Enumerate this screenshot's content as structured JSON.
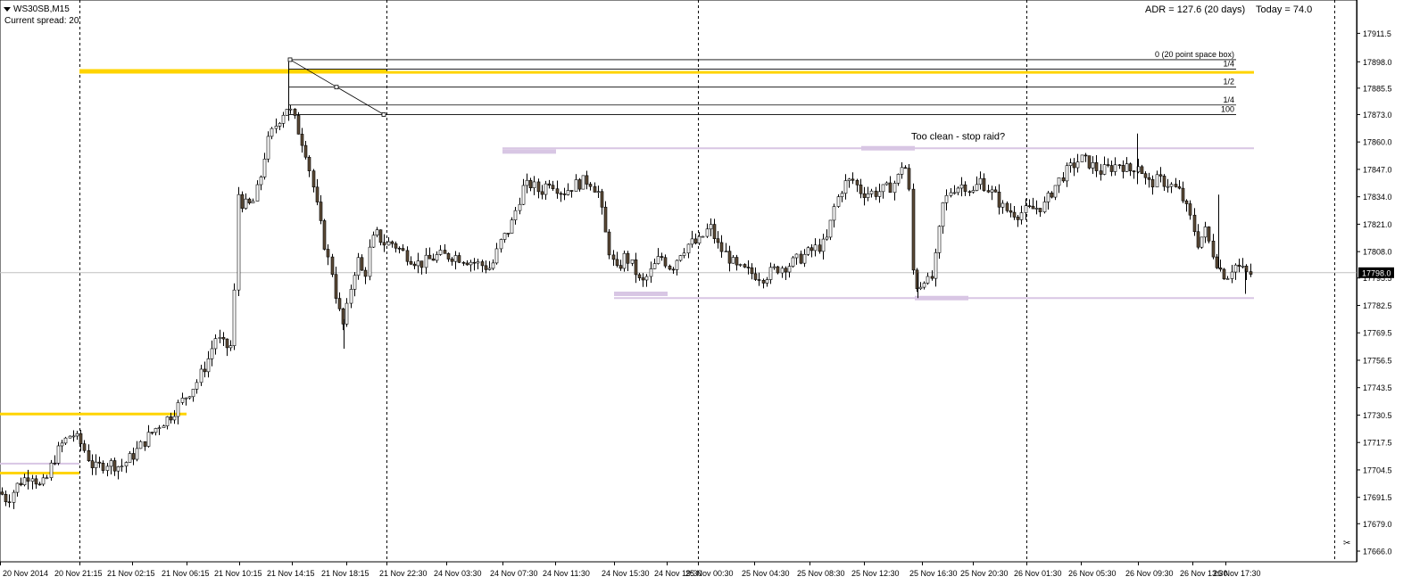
{
  "header": {
    "symbol": "WS30SB,M15",
    "spread_label": "Current spread: 20",
    "adr": "ADR = 127.6  (20 days)",
    "today": "Today = 74.0"
  },
  "colors": {
    "background": "#ffffff",
    "bull_body": "#ffffff",
    "bear_body": "#5c4a36",
    "wick": "#000000",
    "gold_level": "#ffd400",
    "lavender_level": "#d8c6e4",
    "current_price_line": "#c0c0c0"
  },
  "chart_data": {
    "type": "candlestick",
    "symbol": "WS30SB",
    "timeframe": "M15",
    "ylim": [
      17666.0,
      17918.0
    ],
    "y_ticks": [
      "17911.5",
      "17898.0",
      "17885.5",
      "17873.0",
      "17860.0",
      "17847.0",
      "17834.0",
      "17821.0",
      "17808.0",
      "17795.5",
      "17782.5",
      "17769.5",
      "17756.5",
      "17743.5",
      "17730.5",
      "17717.5",
      "17704.5",
      "17691.5",
      "17679.0",
      "17666.0"
    ],
    "y_tick_values": [
      17911.5,
      17898.0,
      17885.5,
      17873.0,
      17860.0,
      17847.0,
      17834.0,
      17821.0,
      17808.0,
      17795.5,
      17782.5,
      17769.5,
      17756.5,
      17743.5,
      17730.5,
      17717.5,
      17704.5,
      17691.5,
      17679.0,
      17666.0
    ],
    "x_ticks": [
      "20 Nov 2014",
      "20 Nov 21:15",
      "21 Nov 02:15",
      "21 Nov 06:15",
      "21 Nov 10:15",
      "21 Nov 14:15",
      "21 Nov 18:15",
      "21 Nov 22:30",
      "24 Nov 03:30",
      "24 Nov 07:30",
      "24 Nov 11:30",
      "24 Nov 15:30",
      "24 Nov 19:30",
      "25 Nov 00:30",
      "25 Nov 04:30",
      "25 Nov 08:30",
      "25 Nov 12:30",
      "25 Nov 16:30",
      "25 Nov 20:30",
      "26 Nov 01:30",
      "26 Nov 05:30",
      "26 Nov 09:30",
      "26 Nov 13:30",
      "26 Nov 17:30"
    ],
    "session_separators": [
      "20 Nov 21:15",
      "21 Nov 22:30",
      "25 Nov 00:30",
      "26 Nov 01:30"
    ],
    "current_price": 17798.0,
    "current_price_label": "17798.0",
    "path_key": [
      [
        0,
        17694
      ],
      [
        8,
        17690
      ],
      [
        20,
        17698
      ],
      [
        35,
        17703
      ],
      [
        45,
        17696
      ],
      [
        52,
        17700
      ],
      [
        58,
        17708
      ],
      [
        68,
        17716
      ],
      [
        80,
        17722
      ],
      [
        92,
        17716
      ],
      [
        105,
        17705
      ],
      [
        120,
        17708
      ],
      [
        135,
        17706
      ],
      [
        150,
        17712
      ],
      [
        165,
        17720
      ],
      [
        178,
        17726
      ],
      [
        190,
        17730
      ],
      [
        205,
        17738
      ],
      [
        220,
        17746
      ],
      [
        232,
        17756
      ],
      [
        242,
        17768
      ],
      [
        248,
        17764
      ],
      [
        258,
        17762
      ],
      [
        262,
        17783
      ],
      [
        266,
        17836
      ],
      [
        272,
        17830
      ],
      [
        282,
        17830
      ],
      [
        290,
        17840
      ],
      [
        298,
        17858
      ],
      [
        306,
        17866
      ],
      [
        315,
        17873
      ],
      [
        322,
        17877
      ],
      [
        328,
        17872
      ],
      [
        335,
        17864
      ],
      [
        342,
        17856
      ],
      [
        350,
        17840
      ],
      [
        358,
        17822
      ],
      [
        366,
        17806
      ],
      [
        372,
        17798
      ],
      [
        378,
        17782
      ],
      [
        385,
        17772
      ],
      [
        392,
        17790
      ],
      [
        400,
        17805
      ],
      [
        408,
        17795
      ],
      [
        415,
        17812
      ],
      [
        422,
        17816
      ],
      [
        430,
        17812
      ],
      [
        440,
        17812
      ],
      [
        450,
        17808
      ],
      [
        470,
        17802
      ],
      [
        490,
        17806
      ],
      [
        510,
        17806
      ],
      [
        530,
        17803
      ],
      [
        550,
        17800
      ],
      [
        560,
        17812
      ],
      [
        572,
        17820
      ],
      [
        585,
        17838
      ],
      [
        595,
        17840
      ],
      [
        605,
        17836
      ],
      [
        615,
        17842
      ],
      [
        630,
        17836
      ],
      [
        645,
        17840
      ],
      [
        660,
        17842
      ],
      [
        670,
        17836
      ],
      [
        680,
        17812
      ],
      [
        690,
        17798
      ],
      [
        700,
        17806
      ],
      [
        710,
        17800
      ],
      [
        718,
        17792
      ],
      [
        728,
        17798
      ],
      [
        740,
        17806
      ],
      [
        752,
        17800
      ],
      [
        762,
        17808
      ],
      [
        772,
        17812
      ],
      [
        782,
        17812
      ],
      [
        795,
        17820
      ],
      [
        805,
        17810
      ],
      [
        815,
        17806
      ],
      [
        825,
        17800
      ],
      [
        840,
        17798
      ],
      [
        855,
        17796
      ],
      [
        870,
        17800
      ],
      [
        885,
        17802
      ],
      [
        900,
        17806
      ],
      [
        915,
        17810
      ],
      [
        925,
        17812
      ],
      [
        935,
        17830
      ],
      [
        945,
        17840
      ],
      [
        955,
        17842
      ],
      [
        965,
        17836
      ],
      [
        980,
        17836
      ],
      [
        995,
        17838
      ],
      [
        1005,
        17842
      ],
      [
        1012,
        17852
      ],
      [
        1018,
        17840
      ],
      [
        1022,
        17800
      ],
      [
        1028,
        17790
      ],
      [
        1035,
        17796
      ],
      [
        1042,
        17792
      ],
      [
        1048,
        17805
      ],
      [
        1056,
        17830
      ],
      [
        1066,
        17838
      ],
      [
        1080,
        17840
      ],
      [
        1090,
        17836
      ],
      [
        1098,
        17842
      ],
      [
        1106,
        17838
      ],
      [
        1115,
        17834
      ],
      [
        1125,
        17828
      ],
      [
        1140,
        17826
      ],
      [
        1155,
        17828
      ],
      [
        1170,
        17830
      ],
      [
        1180,
        17838
      ],
      [
        1190,
        17844
      ],
      [
        1200,
        17848
      ],
      [
        1210,
        17852
      ],
      [
        1220,
        17850
      ],
      [
        1232,
        17846
      ],
      [
        1245,
        17848
      ],
      [
        1255,
        17850
      ],
      [
        1265,
        17846
      ],
      [
        1275,
        17850
      ],
      [
        1285,
        17840
      ],
      [
        1298,
        17842
      ],
      [
        1310,
        17840
      ],
      [
        1322,
        17836
      ],
      [
        1335,
        17822
      ],
      [
        1342,
        17812
      ],
      [
        1350,
        17818
      ],
      [
        1358,
        17808
      ],
      [
        1366,
        17800
      ],
      [
        1374,
        17796
      ],
      [
        1382,
        17802
      ],
      [
        1390,
        17800
      ],
      [
        1398,
        17797
      ],
      [
        1404,
        17798
      ]
    ],
    "levels": [
      {
        "price": 17893.5,
        "from": "20 Nov 21:15",
        "style": "gold-thick"
      },
      {
        "price": 17893.0,
        "from": "21 Nov 22:30",
        "style": "gold"
      },
      {
        "price": 17731.0,
        "from": "20 Nov 2014",
        "to": "21 Nov 06:15",
        "style": "gold"
      },
      {
        "price": 17703.0,
        "from": "20 Nov 2014",
        "to": "20 Nov 21:15",
        "style": "gold"
      },
      {
        "price": 17707.5,
        "from": "20 Nov 2014",
        "to": "20 Nov 21:15",
        "style": "lavender"
      },
      {
        "price": 17857.0,
        "from": "24 Nov 07:30",
        "style": "lavender"
      },
      {
        "price": 17855.5,
        "from": "24 Nov 07:30",
        "style": "lavender-thick-stub"
      },
      {
        "price": 17786.0,
        "from": "24 Nov 15:30",
        "style": "lavender"
      },
      {
        "price": 17788.0,
        "from": "24 Nov 15:30",
        "style": "lavender-thick-stub"
      }
    ],
    "fib_levels": [
      {
        "label": "0  (20 point space box)",
        "price": 17899.0
      },
      {
        "label": "1/4",
        "price": 17894.5
      },
      {
        "label": "1/2",
        "price": 17886.0
      },
      {
        "label": "1/4",
        "price": 17877.5
      },
      {
        "label": "100",
        "price": 17873.0
      }
    ],
    "annotations": [
      {
        "text": "Too clean - stop raid?",
        "at": "25 Nov 12:30",
        "price": 17859.0
      }
    ]
  }
}
